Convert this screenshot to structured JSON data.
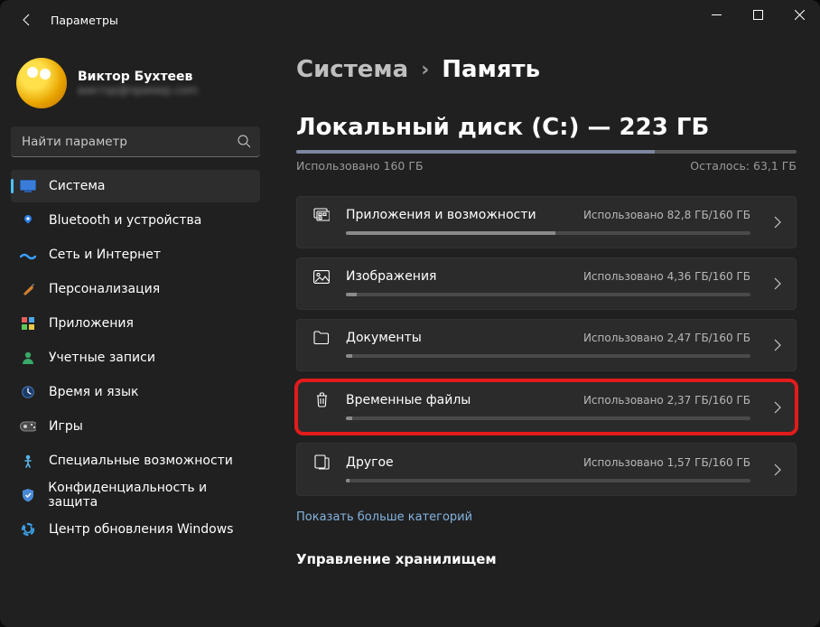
{
  "app_title": "Параметры",
  "profile": {
    "name": "Виктор Бухтеев",
    "email": "виктор@пример.com"
  },
  "search": {
    "placeholder": "Найти параметр"
  },
  "sidebar": {
    "items": [
      {
        "label": "Система"
      },
      {
        "label": "Bluetooth и устройства"
      },
      {
        "label": "Сеть и Интернет"
      },
      {
        "label": "Персонализация"
      },
      {
        "label": "Приложения"
      },
      {
        "label": "Учетные записи"
      },
      {
        "label": "Время и язык"
      },
      {
        "label": "Игры"
      },
      {
        "label": "Специальные возможности"
      },
      {
        "label": "Конфиденциальность и защита"
      },
      {
        "label": "Центр обновления Windows"
      }
    ]
  },
  "breadcrumb": {
    "root": "Система",
    "current": "Память"
  },
  "disk": {
    "title": "Локальный диск (C:) — 223 ГБ",
    "used_label": "Использовано 160 ГБ",
    "free_label": "Осталось: 63,1 ГБ",
    "used_gb": 160,
    "total_gb": 223,
    "fill_pct": 71.7
  },
  "categories": [
    {
      "label": "Приложения и возможности",
      "usage": "Использовано 82,8 ГБ/160 ГБ",
      "pct": 51.8,
      "icon": "apps"
    },
    {
      "label": "Изображения",
      "usage": "Использовано 4,36 ГБ/160 ГБ",
      "pct": 2.7,
      "icon": "image"
    },
    {
      "label": "Документы",
      "usage": "Использовано 2,47 ГБ/160 ГБ",
      "pct": 1.5,
      "icon": "document"
    },
    {
      "label": "Временные файлы",
      "usage": "Использовано 2,37 ГБ/160 ГБ",
      "pct": 1.5,
      "icon": "trash",
      "highlight": true
    },
    {
      "label": "Другое",
      "usage": "Использовано 1,57 ГБ/160 ГБ",
      "pct": 1.0,
      "icon": "other"
    }
  ],
  "show_more": "Показать больше категорий",
  "section_header": "Управление хранилищем"
}
